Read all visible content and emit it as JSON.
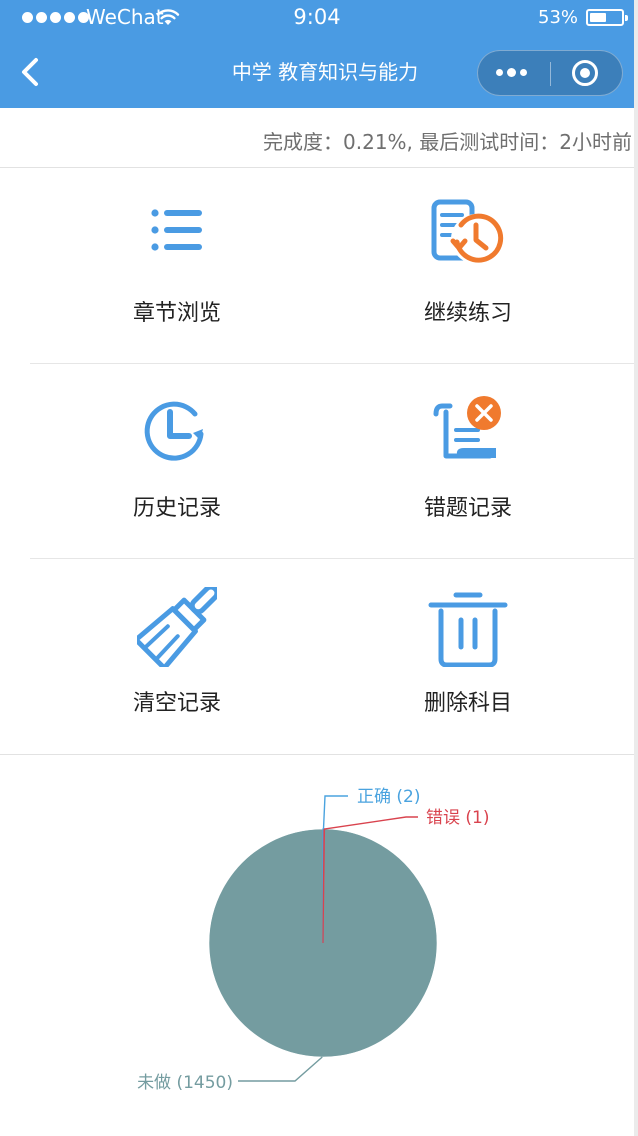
{
  "status_bar": {
    "carrier": "WeChat",
    "time": "9:04",
    "battery": "53%",
    "battery_level": 0.53
  },
  "nav": {
    "title": "中学 教育知识与能力"
  },
  "progress": {
    "text": "完成度：0.21%, 最后测试时间：2小时前"
  },
  "menu": [
    {
      "label": "章节浏览",
      "icon": "list-icon"
    },
    {
      "label": "继续练习",
      "icon": "clock-document-icon"
    },
    {
      "label": "历史记录",
      "icon": "history-icon"
    },
    {
      "label": "错题记录",
      "icon": "wrong-answers-icon"
    },
    {
      "label": "清空记录",
      "icon": "brush-icon"
    },
    {
      "label": "删除科目",
      "icon": "trash-icon"
    }
  ],
  "colors": {
    "header": "#4a9be3",
    "icon_blue": "#4a9be3",
    "icon_orange": "#f07a2e",
    "pie_unanswered": "#749ca0",
    "pie_correct": "#4aa3df",
    "pie_wrong": "#d9434e"
  },
  "chart_data": {
    "type": "pie",
    "series": [
      {
        "label": "正确 (2)",
        "value": 2,
        "color": "#4aa3df"
      },
      {
        "label": "错误 (1)",
        "value": 1,
        "color": "#d9434e"
      },
      {
        "label": "未做 (1450)",
        "value": 1450,
        "color": "#749ca0"
      }
    ]
  }
}
